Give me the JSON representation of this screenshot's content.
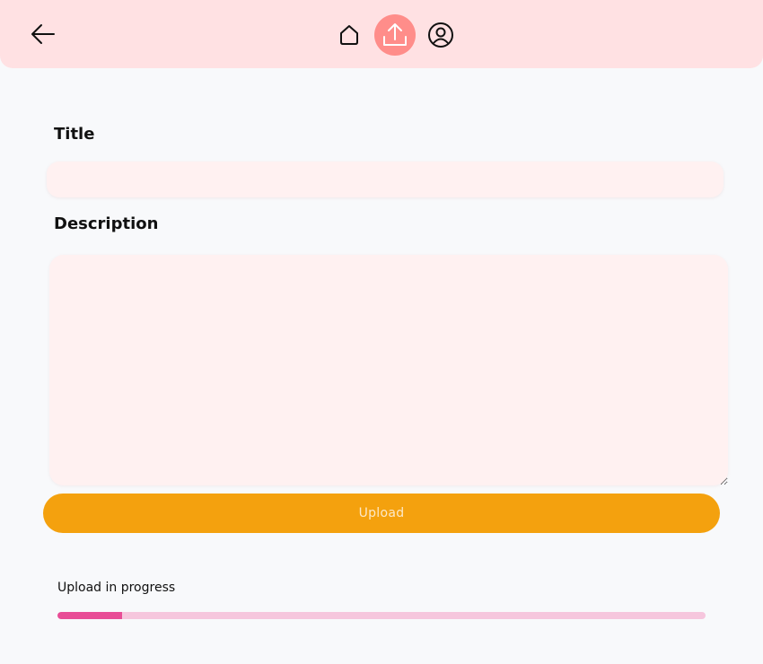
{
  "header": {
    "back_icon": "arrow-left-icon",
    "nav": [
      {
        "icon": "home-icon",
        "active": false
      },
      {
        "icon": "upload-icon",
        "active": true
      },
      {
        "icon": "profile-icon",
        "active": false
      }
    ],
    "background_color": "#ffe1e3",
    "active_color": "#ff8d8a"
  },
  "form": {
    "title_label": "Title",
    "title_value": "",
    "description_label": "Description",
    "description_value": "",
    "field_color": "#fff1f1"
  },
  "upload_button": {
    "label": "Upload",
    "color": "#f4a10e"
  },
  "progress": {
    "label": "Upload in progress",
    "percent": 10,
    "track_color": "#f6c6dd",
    "fill_color": "#e84d96"
  }
}
